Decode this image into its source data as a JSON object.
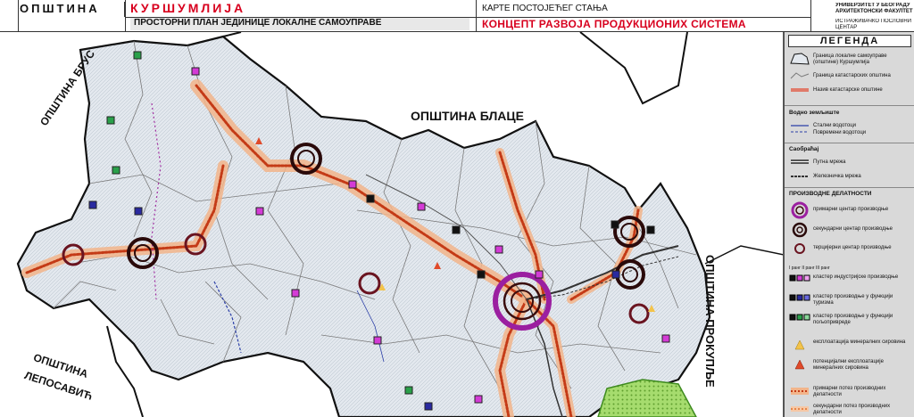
{
  "header": {
    "municipality_label": "ОПШТИНА",
    "municipality_name": "КУРШУМЛИЈА",
    "plan_subtitle": "ПРОСТОРНИ ПЛАН ЈЕДИНИЦЕ ЛОКАЛНЕ САМОУПРАВЕ",
    "map_type": "КАРТЕ ПОСТОЈЕЋЕГ СТАЊА",
    "map_title": "КОНЦЕПТ РАЗВОЈА ПРОДУКЦИОНИХ СИСТЕМА",
    "university": "УНИВЕРЗИТЕТ У БЕОГРАДУ АРХИТЕКТОНСКИ ФАКУЛТЕТ",
    "institute": "ИСТРАЖИВАЧКО ПОСЛОВНИ ЦЕНТАР"
  },
  "map": {
    "neighbor_brus": "ОПШТИНА БРУС",
    "neighbor_blace": "ОПШТИНА БЛАЦЕ",
    "neighbor_leposavic_1": "ОПШТИНА",
    "neighbor_leposavic_2": "ЛЕПОСАВИЋ",
    "neighbor_prokuplje": "ОПШТИНА ПРОКУПЉЕ",
    "colors": {
      "territory_fill": "#dfe6ee",
      "boundary": "#111111",
      "cadastral": "#8a8a8a",
      "road_orange": "#e0702a",
      "railway": "#333333",
      "primary_center": "#9b1fa0",
      "secondary_center": "#3a0d0d",
      "tertiary_center": "#7a1f2a",
      "water_blue": "#2b3fa8",
      "forest_green": "#8fcf5a",
      "industry_square": "#d43bd6",
      "tourism_square": "#2a2aa0",
      "agriculture_square": "#2aa04a"
    }
  },
  "legend": {
    "title": "ЛЕГЕНДА",
    "items": [
      {
        "icon": "municipality-boundary-icon",
        "text": "Граница локалне самоуправе (општине) Куршумлија"
      },
      {
        "icon": "cadastral-boundary-icon",
        "text": "Граница катастарских општина"
      },
      {
        "icon": "cadastral-name-icon",
        "text": "Назив катастарске општине"
      }
    ],
    "water_section": "Водно земљиште",
    "water_items": [
      {
        "icon": "permanent-stream-icon",
        "text": "Стални водотоци"
      },
      {
        "icon": "seasonal-stream-icon",
        "text": "Повремени водотоци"
      }
    ],
    "traffic_section": "Саобраћај",
    "traffic_items": [
      {
        "icon": "road-network-icon",
        "text": "Путна мрежа"
      },
      {
        "icon": "railway-icon",
        "text": "Железничка мрежа"
      }
    ],
    "production_section": "ПРОИЗВОДНЕ ДЕЛАТНОСТИ",
    "production_items": [
      {
        "icon": "primary-center-icon",
        "text": "примарни центар производње"
      },
      {
        "icon": "secondary-center-icon",
        "text": "секундарни центар производње"
      },
      {
        "icon": "tertiary-center-icon",
        "text": "терцијерни центар производње"
      }
    ],
    "rank_header": "I ранг  II ранг  III ранг",
    "cluster_items": [
      {
        "icon": "industry-cluster-icon",
        "text": "кластер индустријске производње"
      },
      {
        "icon": "tourism-cluster-icon",
        "text": "кластер производње у функцији туризма"
      },
      {
        "icon": "agriculture-cluster-icon",
        "text": "кластер производње у функцији пољопривреде"
      }
    ],
    "mineral_items": [
      {
        "icon": "mineral-exploitation-icon",
        "text": "експлоатација минералних сировина"
      },
      {
        "icon": "mineral-potential-icon",
        "text": "потенцијални експлоатације минералних сировина"
      }
    ],
    "flow_items": [
      {
        "icon": "primary-flow-icon",
        "text": "примарни потез производних делатности"
      },
      {
        "icon": "secondary-flow-icon",
        "text": "секундарни потез производних делатности"
      }
    ]
  }
}
